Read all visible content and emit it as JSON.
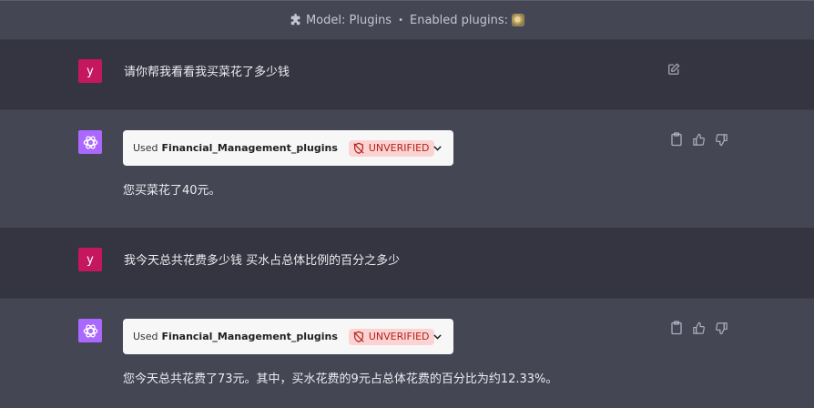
{
  "header": {
    "model_label": "Model: Plugins",
    "separator": "•",
    "enabled_label": "Enabled plugins:"
  },
  "conversation": [
    {
      "role": "user",
      "avatar": "y",
      "text": "请你帮我看看我买菜花了多少钱"
    },
    {
      "role": "assistant",
      "plugin": {
        "used_label": "Used",
        "name": "Financial_Management_plugins",
        "status": "UNVERIFIED"
      },
      "text": "您买菜花了40元。"
    },
    {
      "role": "user",
      "avatar": "y",
      "text": "我今天总共花费多少钱 买水占总体比例的百分之多少"
    },
    {
      "role": "assistant",
      "plugin": {
        "used_label": "Used",
        "name": "Financial_Management_plugins",
        "status": "UNVERIFIED"
      },
      "text": "您今天总共花费了73元。其中，买水花费的9元占总体花费的百分比为约12.33%。"
    }
  ],
  "colors": {
    "user_avatar": "#c5175f",
    "assistant_avatar": "#ab68ff",
    "badge_bg": "#fbd3d3",
    "badge_text": "#b42318"
  },
  "icons": [
    "puzzle-icon",
    "plugin-logo-icon",
    "edit-icon",
    "openai-logo-icon",
    "unverified-shield-icon",
    "chevron-down-icon",
    "clipboard-icon",
    "thumbs-up-icon",
    "thumbs-down-icon"
  ]
}
